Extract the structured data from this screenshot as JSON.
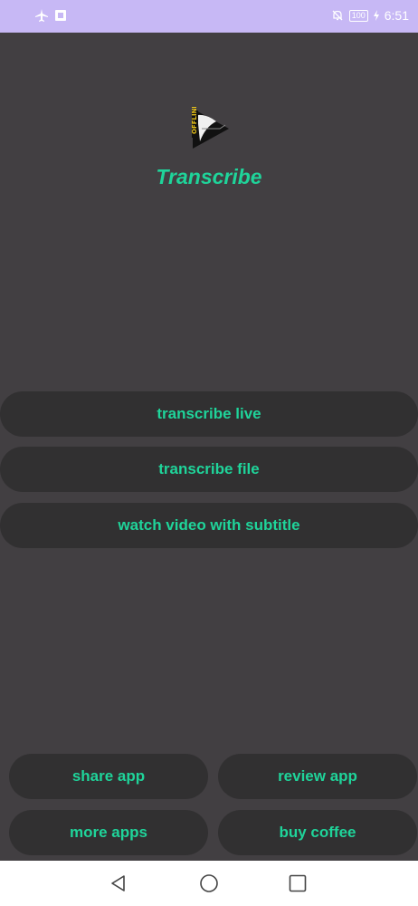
{
  "status_bar": {
    "left_icons": [
      "airplane-icon",
      "notification-app-icon"
    ],
    "right_icons": [
      "mute-bell-icon",
      "battery-icon",
      "charging-icon"
    ],
    "battery_level": "100",
    "time": "6:51"
  },
  "app": {
    "title": "Transcribe",
    "logo_icon": "offline-play-logo",
    "accent_color": "#1fd49a"
  },
  "main_buttons": [
    {
      "label": "transcribe live"
    },
    {
      "label": "transcribe file"
    },
    {
      "label": "watch video with subtitle"
    }
  ],
  "bottom_buttons": [
    {
      "label": "share app"
    },
    {
      "label": "review app"
    },
    {
      "label": "more apps"
    },
    {
      "label": "buy coffee"
    }
  ],
  "nav_bar": {
    "icons": [
      "back-icon",
      "home-icon",
      "recents-icon"
    ]
  }
}
